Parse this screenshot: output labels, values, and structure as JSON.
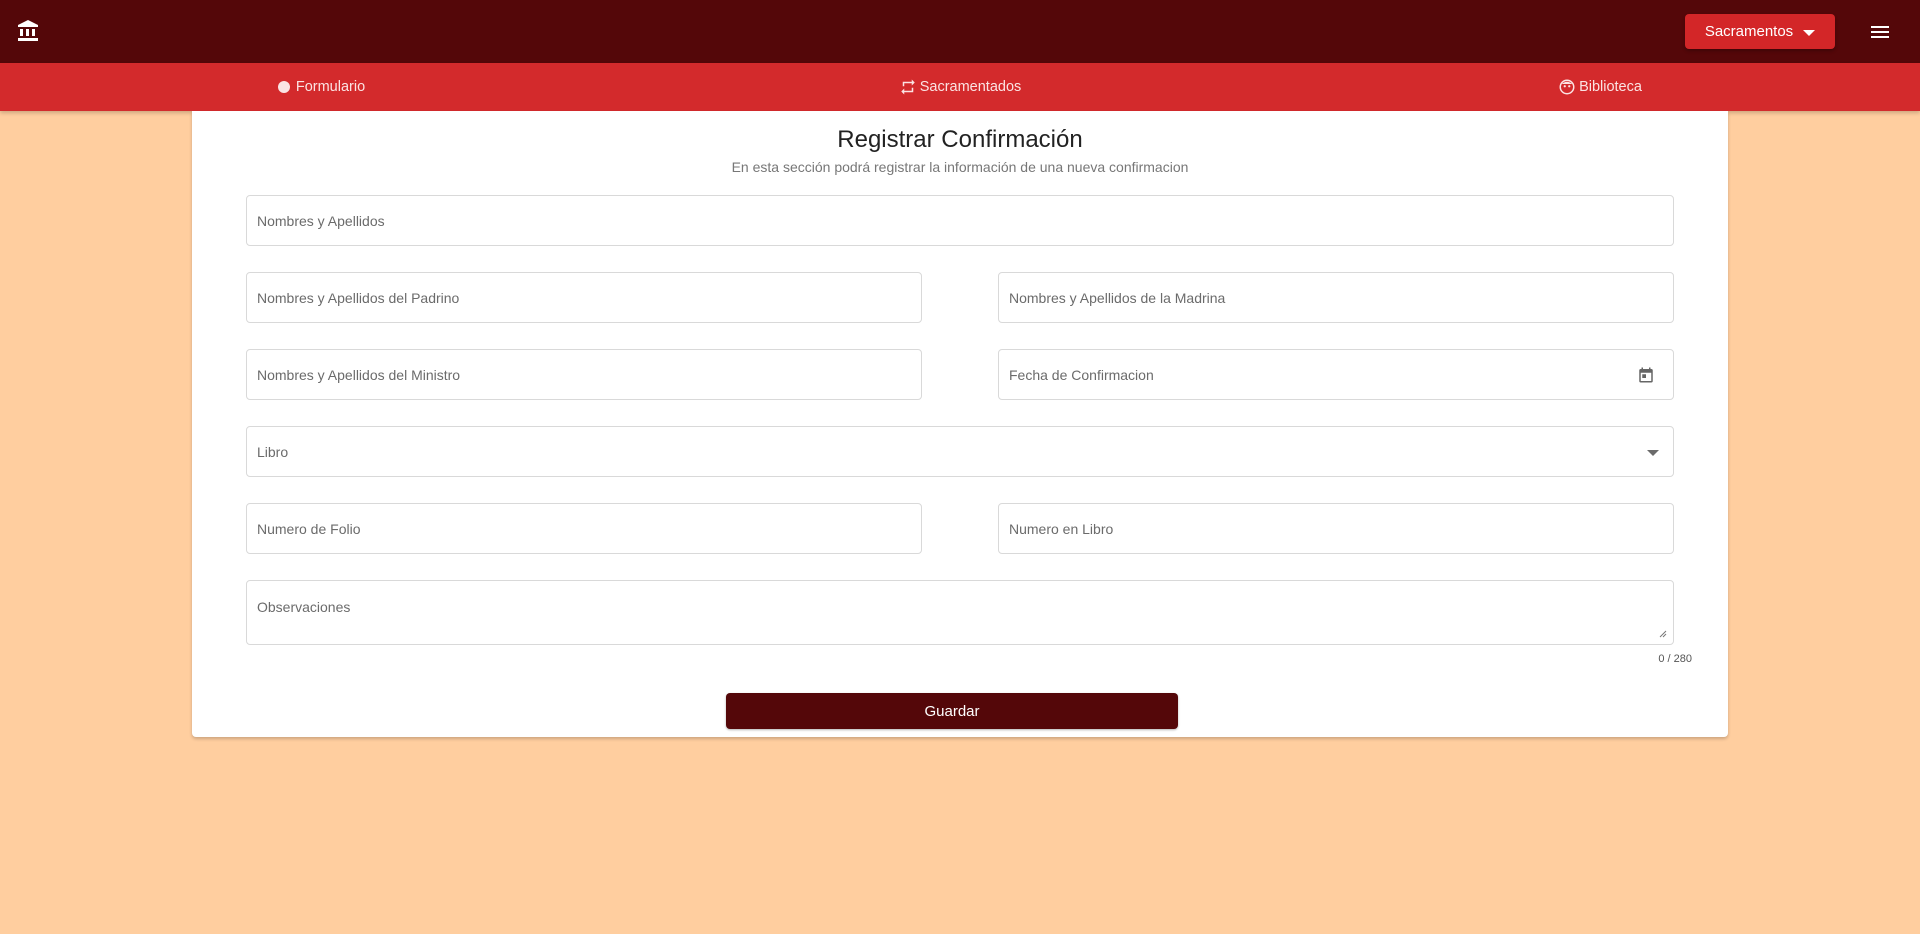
{
  "header": {
    "logo_icon": "bank-icon",
    "menu_button_label": "Sacramentos",
    "hamburger_icon": "menu-icon"
  },
  "tabs": [
    {
      "label": "Formulario",
      "icon": "circle-icon"
    },
    {
      "label": "Sacramentados",
      "icon": "repeat-icon"
    },
    {
      "label": "Biblioteca",
      "icon": "face-icon"
    }
  ],
  "form": {
    "title": "Registrar Confirmación",
    "subtitle": "En esta sección podrá registrar la información de una nueva confirmacion",
    "fields": {
      "nombres": "Nombres y Apellidos",
      "padrino": "Nombres y Apellidos del Padrino",
      "madrina": "Nombres y Apellidos de la Madrina",
      "ministro": "Nombres y Apellidos del Ministro",
      "fecha": "Fecha de Confirmacion",
      "libro": "Libro",
      "folio": "Numero de Folio",
      "numero_libro": "Numero en Libro",
      "observaciones": "Observaciones"
    },
    "counter": "0 / 280",
    "save_label": "Guardar"
  },
  "colors": {
    "topbar": "#540709",
    "tabbar": "#D32A2C",
    "background": "#FFCE9F",
    "button_primary": "#540709",
    "button_accent": "#D32628"
  }
}
